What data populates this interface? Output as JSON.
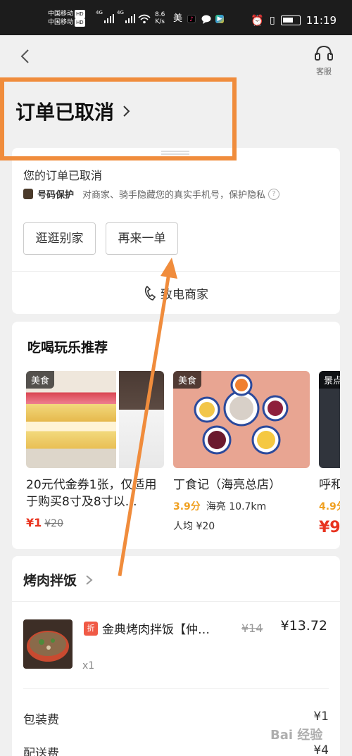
{
  "status_bar": {
    "carrier1": "中国移动",
    "carrier2": "中国移动",
    "hd_badge": "HD",
    "signal_label_1": "4G",
    "signal_label_2": "4G",
    "net_speed": "8.6",
    "net_speed_unit": "K/s",
    "app_icon_mei": "美",
    "time": "11:19"
  },
  "header": {
    "service_label": "客服"
  },
  "order": {
    "title": "订单已取消",
    "status_text": "您的订单已取消",
    "privacy_title": "号码保护",
    "privacy_desc": "对商家、骑手隐藏您的真实手机号，保护隐私",
    "help_symbol": "?",
    "btn_browse": "逛逛别家",
    "btn_reorder": "再来一单",
    "call_label": "致电商家"
  },
  "recommend": {
    "title": "吃喝玩乐推荐",
    "items": [
      {
        "tag": "美食",
        "name": "20元代金券1张，仅适用于购买8寸及8寸以…",
        "price": "¥1",
        "old_price": "¥20"
      },
      {
        "tag": "美食",
        "name": "丁食记（海亮总店）",
        "rating": "3.9分",
        "location": "海亮 10.7km",
        "avg": "人均 ¥20"
      },
      {
        "tag": "景点",
        "name": "呼和",
        "rating": "4.9分",
        "price": "¥9."
      }
    ]
  },
  "shop": {
    "name": "烤肉拌饭",
    "item": {
      "discount_tag": "折",
      "name": "金典烤肉拌饭【仲…",
      "old_price": "¥14",
      "price": "¥13.72",
      "qty": "x1"
    },
    "fees": [
      {
        "label": "包装费",
        "value": "¥1"
      },
      {
        "label": "配送费",
        "value": "¥4"
      }
    ]
  },
  "watermark": "Bai 经验",
  "colors": {
    "highlight": "#f08c3c",
    "price_red": "#e8331f",
    "rating": "#f0a020"
  }
}
